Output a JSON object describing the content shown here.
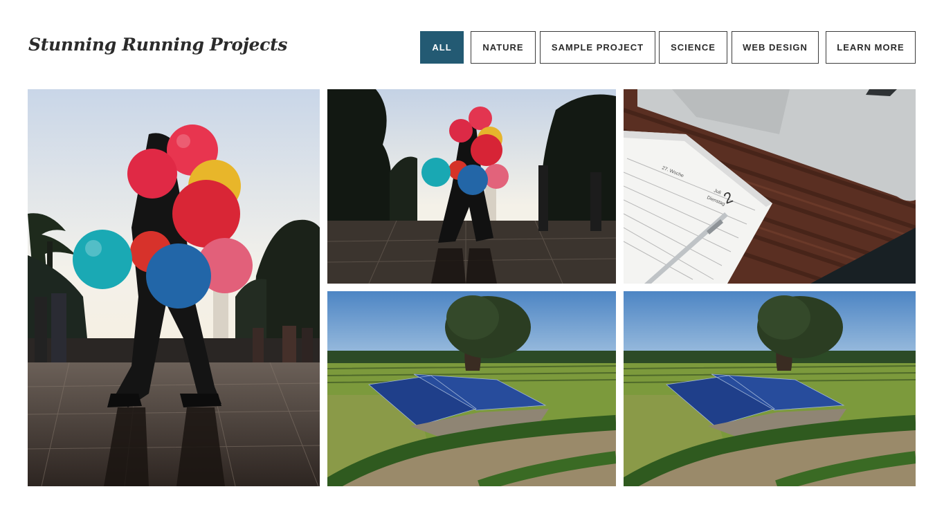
{
  "header": {
    "title": "Stunning Running Projects"
  },
  "filters": {
    "active": "ALL",
    "active_color": "#235a73",
    "items": [
      {
        "label": "ALL"
      },
      {
        "label": "NATURE"
      },
      {
        "label": "SAMPLE PROJECT"
      },
      {
        "label": "SCIENCE"
      },
      {
        "label": "WEB DESIGN"
      },
      {
        "label": "LEARN MORE"
      }
    ]
  },
  "gallery": {
    "items": [
      {
        "image": "balloon-vendor-large"
      },
      {
        "image": "balloon-vendor"
      },
      {
        "image": "planner-and-laptop",
        "calendar_day": "2",
        "calendar_week": "27. Woche",
        "calendar_month": "Juli",
        "calendar_weekday": "Dienstag"
      },
      {
        "image": "solar-panels-vineyard"
      },
      {
        "image": "solar-panels-vineyard"
      }
    ]
  }
}
